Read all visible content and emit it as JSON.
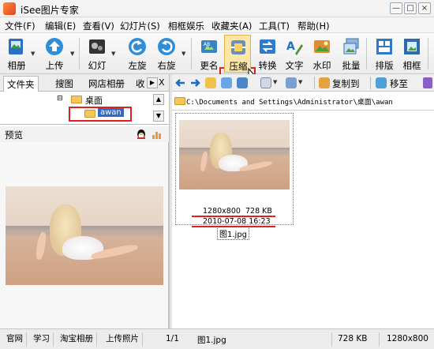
{
  "window": {
    "title": "iSee图片专家",
    "controls": [
      "—",
      "□",
      "×"
    ]
  },
  "menu": [
    "文件(F)",
    "编辑(E)",
    "查看(V)",
    "幻灯片(S)",
    "相框娱乐",
    "收藏夹(A)",
    "工具(T)",
    "帮助(H)"
  ],
  "toolbar": {
    "album": "相册",
    "upload": "上传",
    "slideshow": "幻灯",
    "rotate_left": "左旋",
    "rotate_right": "右旋",
    "rename": "更名",
    "compress": "压缩",
    "convert": "转换",
    "text": "文字",
    "watermark": "水印",
    "batch": "批量",
    "layout": "排版",
    "frame": "相框"
  },
  "left_panel": {
    "tabs": [
      "文件夹",
      "搜图",
      "网店相册",
      "收"
    ],
    "tab_close": "X",
    "tree": {
      "desktop": "桌面",
      "selected": "awan"
    },
    "preview_label": "预览"
  },
  "right_toolbar": {
    "copy_to": "复制到",
    "move_to": "移至"
  },
  "address": "C:\\Documents and Settings\\Administrator\\桌面\\awan",
  "thumbnail": {
    "dimensions": "1280x800",
    "size": "728 KB",
    "date": "2010-07-08 16:23",
    "filename": "图1.jpg"
  },
  "statusbar": {
    "links": [
      "官网",
      "学习",
      "淘宝相册",
      "上传照片"
    ],
    "page": "1/1",
    "file": "图1.jpg",
    "size": "728 KB",
    "dims": "1280x800"
  },
  "colors": {
    "highlight": "#e02020",
    "folder": "#f5c75a",
    "title_bg": "#f3f3f3"
  }
}
